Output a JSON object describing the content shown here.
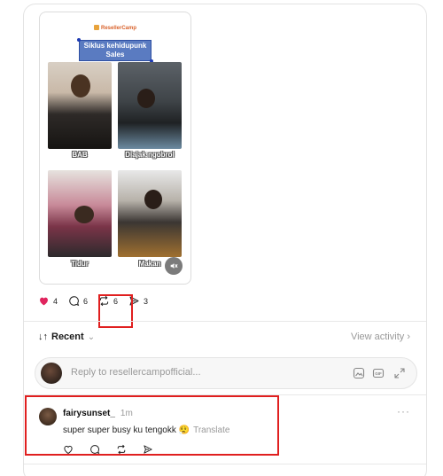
{
  "post": {
    "clipped_text": "",
    "media": {
      "brand": "ResellerCamp",
      "banner_line1": "Siklus kehidupunk",
      "banner_line2": "Sales",
      "captions": [
        "BAB",
        "Diajak ngobrol",
        "Tidur",
        "Makan"
      ],
      "mute_icon": "speaker-muted-icon"
    },
    "actions": {
      "likes": "4",
      "comments": "6",
      "reposts": "6",
      "shares": "3",
      "like_color": "#e0245e"
    }
  },
  "replies": {
    "sort_label": "Recent",
    "view_activity": "View activity",
    "reply_placeholder": "Reply to resellercampofficial..."
  },
  "comment": {
    "username": "fairysunset_",
    "time": "1m",
    "text": "super super busy ku tengokk 😮‍💨",
    "translate": "Translate"
  },
  "highlight_color": "#e01f1f"
}
